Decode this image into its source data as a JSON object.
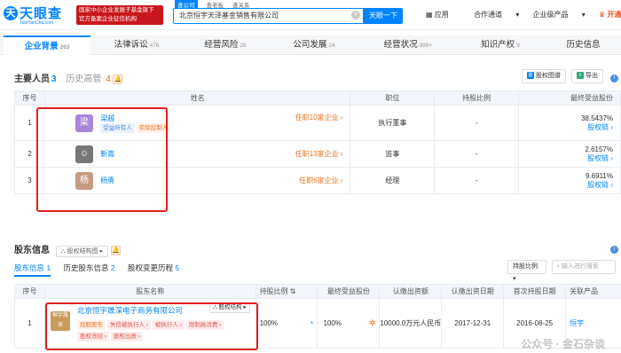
{
  "header": {
    "logo_text": "天眼查",
    "logo_sub": "TianYanCha.com",
    "badge_line1": "国家中小企业发展子基金旗下",
    "badge_line2": "官方备案企业征信机构",
    "search_tabs": [
      "查公司",
      "查老板",
      "查关系"
    ],
    "search_value": "北京恒宇天泽基金销售有限公司",
    "search_button": "天眼一下",
    "nav": [
      "应用",
      "合作通道",
      "企业级产品",
      "开通会员"
    ]
  },
  "tabs": [
    {
      "label": "企业背景",
      "count": "263"
    },
    {
      "label": "法律诉讼",
      "count": "476"
    },
    {
      "label": "经营风险",
      "count": "28"
    },
    {
      "label": "公司发展",
      "count": "24"
    },
    {
      "label": "经营状况",
      "count": "999+"
    },
    {
      "label": "知识产权",
      "count": "9"
    },
    {
      "label": "历史信息",
      "count": ""
    }
  ],
  "key_people": {
    "title": "主要人员",
    "count": "3",
    "history_label": "历史高管",
    "history_count": "4",
    "btn_export_chart": "股权图谱",
    "btn_export": "导出",
    "columns": [
      "序号",
      "姓名",
      "职位",
      "持股比例",
      "最终受益股份"
    ],
    "rows": [
      {
        "no": "1",
        "avatar": "梁",
        "name": "梁越",
        "tags": [
          "受益所有人",
          "实际控制人"
        ],
        "companies": "任职10家企业",
        "position": "执行董事",
        "share": "-",
        "benefit": "38.5437%",
        "link": "股权链"
      },
      {
        "no": "2",
        "avatar": "",
        "name": "靳嵩",
        "tags": [],
        "companies": "任职13家企业",
        "position": "监事",
        "share": "-",
        "benefit": "2.6157%",
        "link": "股权链"
      },
      {
        "no": "3",
        "avatar": "杨",
        "name": "杨勇",
        "tags": [],
        "companies": "任职6家企业",
        "position": "经理",
        "share": "-",
        "benefit": "9.6911%",
        "link": "股权链"
      }
    ]
  },
  "shareholders": {
    "title": "股东信息",
    "count": "1",
    "struct_btn": "股权结构图",
    "subtabs": [
      {
        "label": "股东信息",
        "count": "1"
      },
      {
        "label": "历史股东信息",
        "count": "2"
      },
      {
        "label": "股权变更历程",
        "count": "5"
      }
    ],
    "sort_select": "持股比例",
    "search_placeholder": "输入进行搜索",
    "columns": [
      "序号",
      "股东名称",
      "持股比例",
      "最终受益股份",
      "认缴出资额",
      "认缴出资日期",
      "首次持股日期",
      "关联产品"
    ],
    "row": {
      "no": "1",
      "logo": "恒宇晟深",
      "name": "北京恒宇晟深电子商务有限公司",
      "struct": "股权结构",
      "tags": [
        "控股股东",
        "失信被执行人",
        "被执行人",
        "限制高消费",
        "股权冻结",
        "股权出质"
      ],
      "share": "100%",
      "benefit": "100%",
      "amount": "10000.0万元人民币",
      "date": "2017-12-31",
      "first_date": "2016-08-25",
      "product": "恒宇"
    }
  },
  "watermark": "公众号 · 金石杂谈"
}
